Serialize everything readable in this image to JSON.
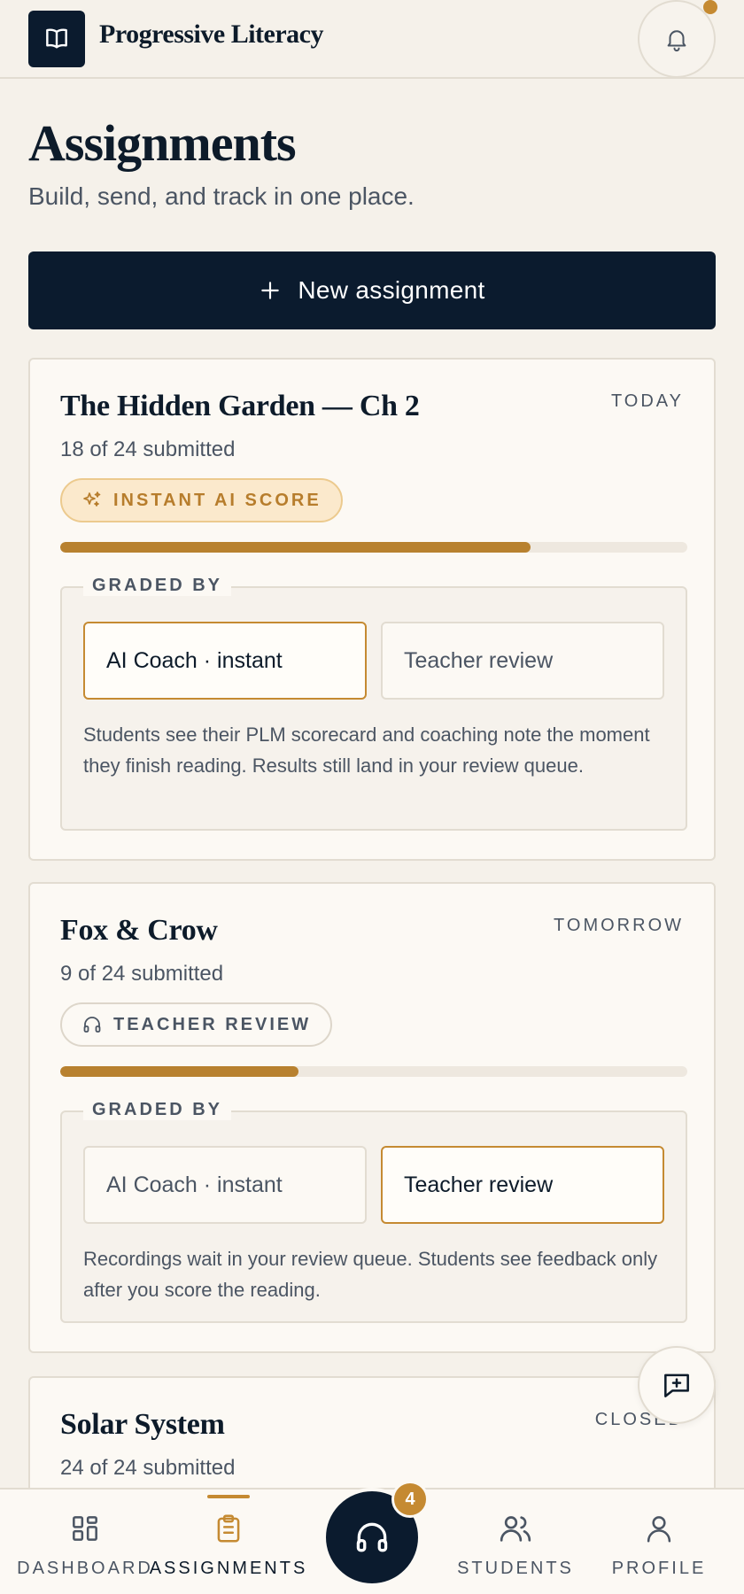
{
  "header": {
    "brand": "Progressive Literacy",
    "logo_icon": "book-icon",
    "notification_icon": "bell-icon"
  },
  "page": {
    "title": "Assignments",
    "subtitle": "Build, send, and track in one place."
  },
  "actions": {
    "new_assignment_label": "New assignment"
  },
  "assignments": [
    {
      "title": "The Hidden Garden — Ch 2",
      "due": "TODAY",
      "submitted": "18 of 24 submitted",
      "progress": 0.75,
      "chip": {
        "label": "INSTANT AI SCORE",
        "icon": "sparkles-icon"
      },
      "graded_by": {
        "legend": "GRADED BY",
        "options": [
          "AI Coach · instant",
          "Teacher review"
        ],
        "selected": 0,
        "note": "Students see their PLM scorecard and coaching note the moment they finish reading. Results still land in your review queue."
      }
    },
    {
      "title": "Fox & Crow",
      "due": "TOMORROW",
      "submitted": "9 of 24 submitted",
      "progress": 0.38,
      "chip": {
        "label": "TEACHER REVIEW",
        "icon": "headphones-icon"
      },
      "graded_by": {
        "legend": "GRADED BY",
        "options": [
          "AI Coach · instant",
          "Teacher review"
        ],
        "selected": 1,
        "note": "Recordings wait in your review queue. Students see feedback only after you score the reading."
      }
    },
    {
      "title": "Solar System",
      "due": "CLOSED",
      "submitted": "24 of 24 submitted"
    }
  ],
  "bottom_nav": {
    "items": [
      {
        "label": "DASHBOARD",
        "icon": "grid-icon"
      },
      {
        "label": "ASSIGNMENTS",
        "icon": "clipboard-icon",
        "active": true
      },
      {
        "label": "STUDENTS",
        "icon": "users-icon"
      },
      {
        "label": "PROFILE",
        "icon": "user-icon"
      }
    ],
    "center_badge": "4",
    "center_icon": "headphones-icon"
  },
  "colors": {
    "background": "#f5f1ea",
    "navy": "#0b1b2e",
    "accent": "#c58a32",
    "progress": "#b8812f"
  }
}
